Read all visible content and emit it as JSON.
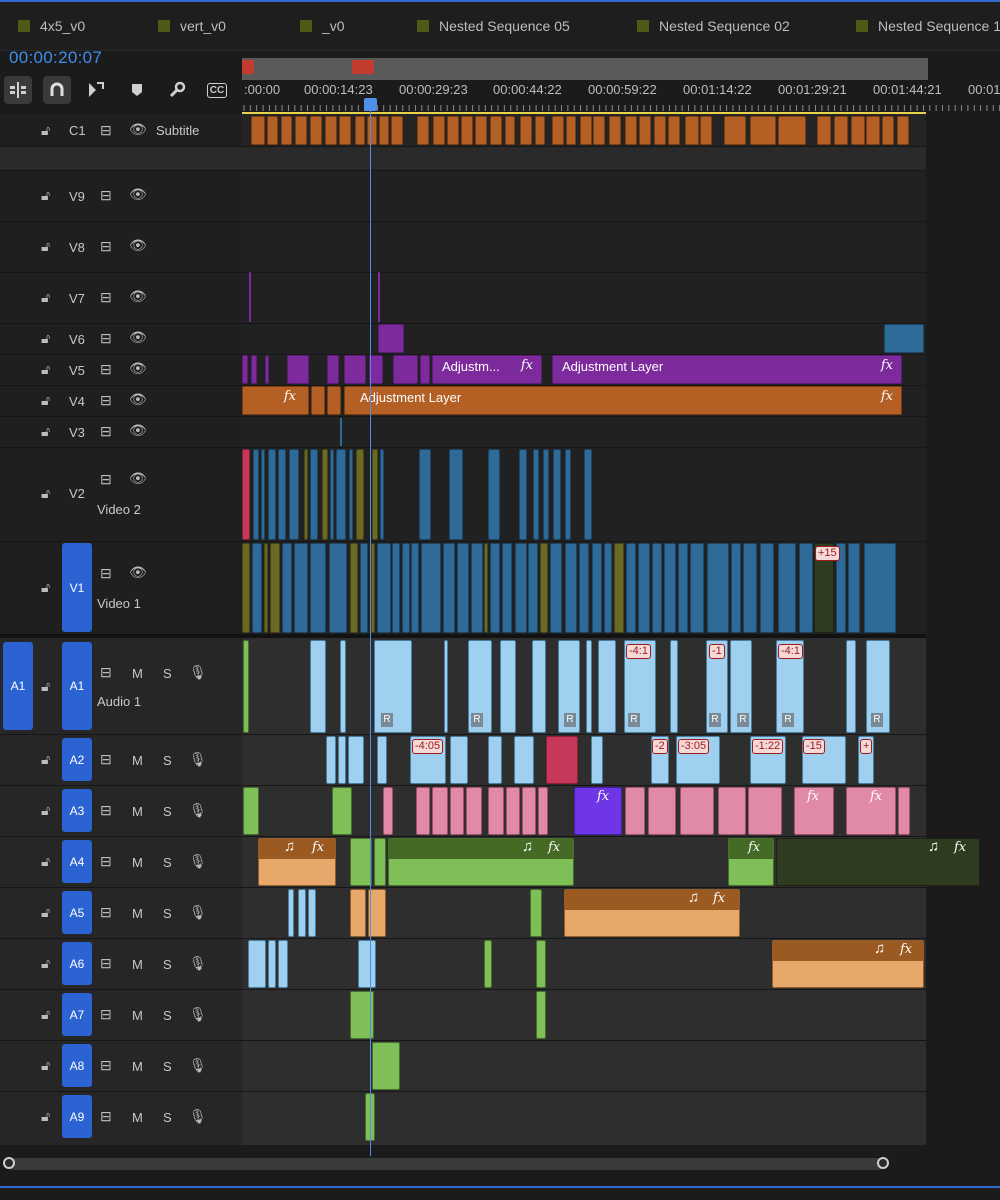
{
  "tabs": [
    {
      "label": "4x5_v0"
    },
    {
      "label": "vert_v0"
    },
    {
      "label": "_v0"
    },
    {
      "label": "Nested Sequence 05"
    },
    {
      "label": "Nested Sequence 02"
    },
    {
      "label": "Nested Sequence 1"
    }
  ],
  "timecode": "00:00:20:07",
  "toolbar": [
    {
      "icon": "insert-nest-icon"
    },
    {
      "icon": "snap-magnet-icon"
    },
    {
      "icon": "linked-selection-icon"
    },
    {
      "icon": "add-marker-icon"
    },
    {
      "icon": "wrench-settings-icon"
    },
    {
      "icon": "captions-cc-icon",
      "label": "CC"
    }
  ],
  "ruler": {
    "ticks": [
      ":00:00",
      "00:00:14:23",
      "00:00:29:23",
      "00:00:44:22",
      "00:00:59:22",
      "00:01:14:22",
      "00:01:29:21",
      "00:01:44:21",
      "00:01"
    ]
  },
  "tracks": {
    "caption": {
      "id": "C1",
      "name": "Subtitle"
    },
    "video": [
      {
        "id": "V9"
      },
      {
        "id": "V8"
      },
      {
        "id": "V7"
      },
      {
        "id": "V6"
      },
      {
        "id": "V5"
      },
      {
        "id": "V4"
      },
      {
        "id": "V3"
      },
      {
        "id": "V2",
        "name": "Video 2"
      },
      {
        "id": "V1",
        "name": "Video 1",
        "source": "V1"
      }
    ],
    "audio": [
      {
        "id": "A1",
        "name": "Audio 1",
        "source": "A1"
      },
      {
        "id": "A2"
      },
      {
        "id": "A3"
      },
      {
        "id": "A4"
      },
      {
        "id": "A5"
      },
      {
        "id": "A6"
      },
      {
        "id": "A7"
      },
      {
        "id": "A8"
      },
      {
        "id": "A9"
      }
    ],
    "mute_label": "M",
    "solo_label": "S"
  },
  "clips": {
    "v5_adjust_short": "Adjustm...",
    "v5_adjust_long": "Adjustment Layer",
    "v4_adjust": "Adjustment Layer",
    "fx": "fx",
    "note": "♫",
    "r_marker": "R",
    "v1_badge": "+15",
    "a1_badges": [
      "-4:1",
      "-1",
      "-4:1"
    ],
    "a2_badges": [
      "-4:05",
      "-2",
      "-3:05",
      "-1:22",
      "-15",
      "+"
    ]
  },
  "colors": {
    "accent": "#2b63d3",
    "timecode": "#3d8eea",
    "playhead": "#4f8fe8",
    "adjustment_orange": "#b45f24",
    "adjustment_purple": "#7c2a9c",
    "video_blue": "#2f6b99",
    "audio_light_blue": "#9fd0ef",
    "audio_pink": "#e08aa5",
    "audio_green": "#7fbf57",
    "audio_tan": "#e7a86a"
  }
}
